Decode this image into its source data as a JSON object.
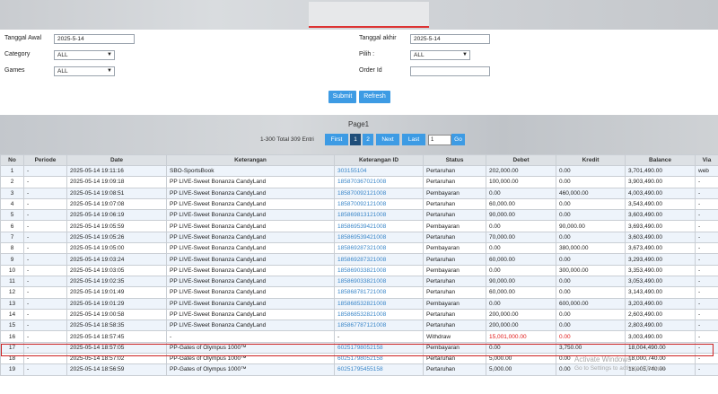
{
  "filters": {
    "tanggal_awal_label": "Tanggal Awal",
    "tanggal_awal_value": "2025-5-14",
    "tanggal_akhir_label": "Tanggal akhir",
    "tanggal_akhir_value": "2025-5-14",
    "category_label": "Category",
    "category_value": "ALL",
    "pilih_label": "Pilih  :",
    "pilih_value": "ALL",
    "games_label": "Games",
    "games_value": "ALL",
    "order_label": "Order Id",
    "order_value": ""
  },
  "buttons": {
    "submit": "Submit",
    "refresh": "Refresh"
  },
  "pager": {
    "title": "Page1",
    "total": "1-300  Total 309 Entri",
    "first": "First",
    "p1": "1",
    "p2": "2",
    "next": "Next",
    "last": "Last",
    "page_input": "1",
    "go": "Go"
  },
  "table": {
    "headers": [
      "No",
      "Periode",
      "Date",
      "Keterangan",
      "Keterangan ID",
      "Status",
      "Debet",
      "Kredit",
      "Balance",
      "Via"
    ],
    "rows": [
      [
        "1",
        "-",
        "2025-05-14 19:11:16",
        "SBO-SportsBook",
        "303155104",
        "Pertaruhan",
        "202,000.00",
        "0.00",
        "3,701,490.00",
        "web"
      ],
      [
        "2",
        "-",
        "2025-05-14 19:09:18",
        "PP LIVE-Sweet Bonanza CandyLand",
        "185870367021008",
        "Pertaruhan",
        "100,000.00",
        "0.00",
        "3,903,490.00",
        "-"
      ],
      [
        "3",
        "-",
        "2025-05-14 19:08:51",
        "PP LIVE-Sweet Bonanza CandyLand",
        "185870092121008",
        "Pembayaran",
        "0.00",
        "460,000.00",
        "4,003,490.00",
        "-"
      ],
      [
        "4",
        "-",
        "2025-05-14 19:07:08",
        "PP LIVE-Sweet Bonanza CandyLand",
        "185870092121008",
        "Pertaruhan",
        "60,000.00",
        "0.00",
        "3,543,490.00",
        "-"
      ],
      [
        "5",
        "-",
        "2025-05-14 19:06:19",
        "PP LIVE-Sweet Bonanza CandyLand",
        "185869813121008",
        "Pertaruhan",
        "90,000.00",
        "0.00",
        "3,603,490.00",
        "-"
      ],
      [
        "6",
        "-",
        "2025-05-14 19:05:59",
        "PP LIVE-Sweet Bonanza CandyLand",
        "185869539421008",
        "Pembayaran",
        "0.00",
        "90,000.00",
        "3,693,490.00",
        "-"
      ],
      [
        "7",
        "-",
        "2025-05-14 19:05:26",
        "PP LIVE-Sweet Bonanza CandyLand",
        "185869539421008",
        "Pertaruhan",
        "70,000.00",
        "0.00",
        "3,603,490.00",
        "-"
      ],
      [
        "8",
        "-",
        "2025-05-14 19:05:00",
        "PP LIVE-Sweet Bonanza CandyLand",
        "185869287321008",
        "Pembayaran",
        "0.00",
        "380,000.00",
        "3,673,490.00",
        "-"
      ],
      [
        "9",
        "-",
        "2025-05-14 19:03:24",
        "PP LIVE-Sweet Bonanza CandyLand",
        "185869287321008",
        "Pertaruhan",
        "60,000.00",
        "0.00",
        "3,293,490.00",
        "-"
      ],
      [
        "10",
        "-",
        "2025-05-14 19:03:05",
        "PP LIVE-Sweet Bonanza CandyLand",
        "185869033821008",
        "Pembayaran",
        "0.00",
        "300,000.00",
        "3,353,490.00",
        "-"
      ],
      [
        "11",
        "-",
        "2025-05-14 19:02:35",
        "PP LIVE-Sweet Bonanza CandyLand",
        "185869033821008",
        "Pertaruhan",
        "90,000.00",
        "0.00",
        "3,053,490.00",
        "-"
      ],
      [
        "12",
        "-",
        "2025-05-14 19:01:49",
        "PP LIVE-Sweet Bonanza CandyLand",
        "185868781721008",
        "Pertaruhan",
        "60,000.00",
        "0.00",
        "3,143,490.00",
        "-"
      ],
      [
        "13",
        "-",
        "2025-05-14 19:01:29",
        "PP LIVE-Sweet Bonanza CandyLand",
        "185868532821008",
        "Pembayaran",
        "0.00",
        "600,000.00",
        "3,203,490.00",
        "-"
      ],
      [
        "14",
        "-",
        "2025-05-14 19:00:58",
        "PP LIVE-Sweet Bonanza CandyLand",
        "185868532821008",
        "Pertaruhan",
        "200,000.00",
        "0.00",
        "2,603,490.00",
        "-"
      ],
      [
        "15",
        "-",
        "2025-05-14 18:58:35",
        "PP LIVE-Sweet Bonanza CandyLand",
        "185867787121008",
        "Pertaruhan",
        "200,000.00",
        "0.00",
        "2,803,490.00",
        "-"
      ],
      [
        "16",
        "-",
        "2025-05-14 18:57:45",
        "-",
        "-",
        "Withdraw",
        "15,001,000.00",
        "0.00",
        "3,003,490.00",
        "-"
      ],
      [
        "17",
        "-",
        "2025-05-14 18:57:05",
        "PP-Gates of Olympus 1000™",
        "60251798052158",
        "Pembayaran",
        "0.00",
        "3,750.00",
        "18,004,490.00",
        "-"
      ],
      [
        "18",
        "-",
        "2025-05-14 18:57:02",
        "PP-Gates of Olympus 1000™",
        "60251798052158",
        "Pertaruhan",
        "5,000.00",
        "0.00",
        "18,000,740.00",
        "-"
      ],
      [
        "19",
        "-",
        "2025-05-14 18:56:59",
        "PP-Gates of Olympus 1000™",
        "60251795455158",
        "Pertaruhan",
        "5,000.00",
        "0.00",
        "18,005,740.00",
        "-"
      ]
    ]
  },
  "watermark": {
    "line1": "Activate Windows",
    "line2": "Go to Settings to activate Windows."
  },
  "colors": {
    "accent": "#3d9be4",
    "highlight": "#cc2222",
    "link": "#3a86c8"
  }
}
